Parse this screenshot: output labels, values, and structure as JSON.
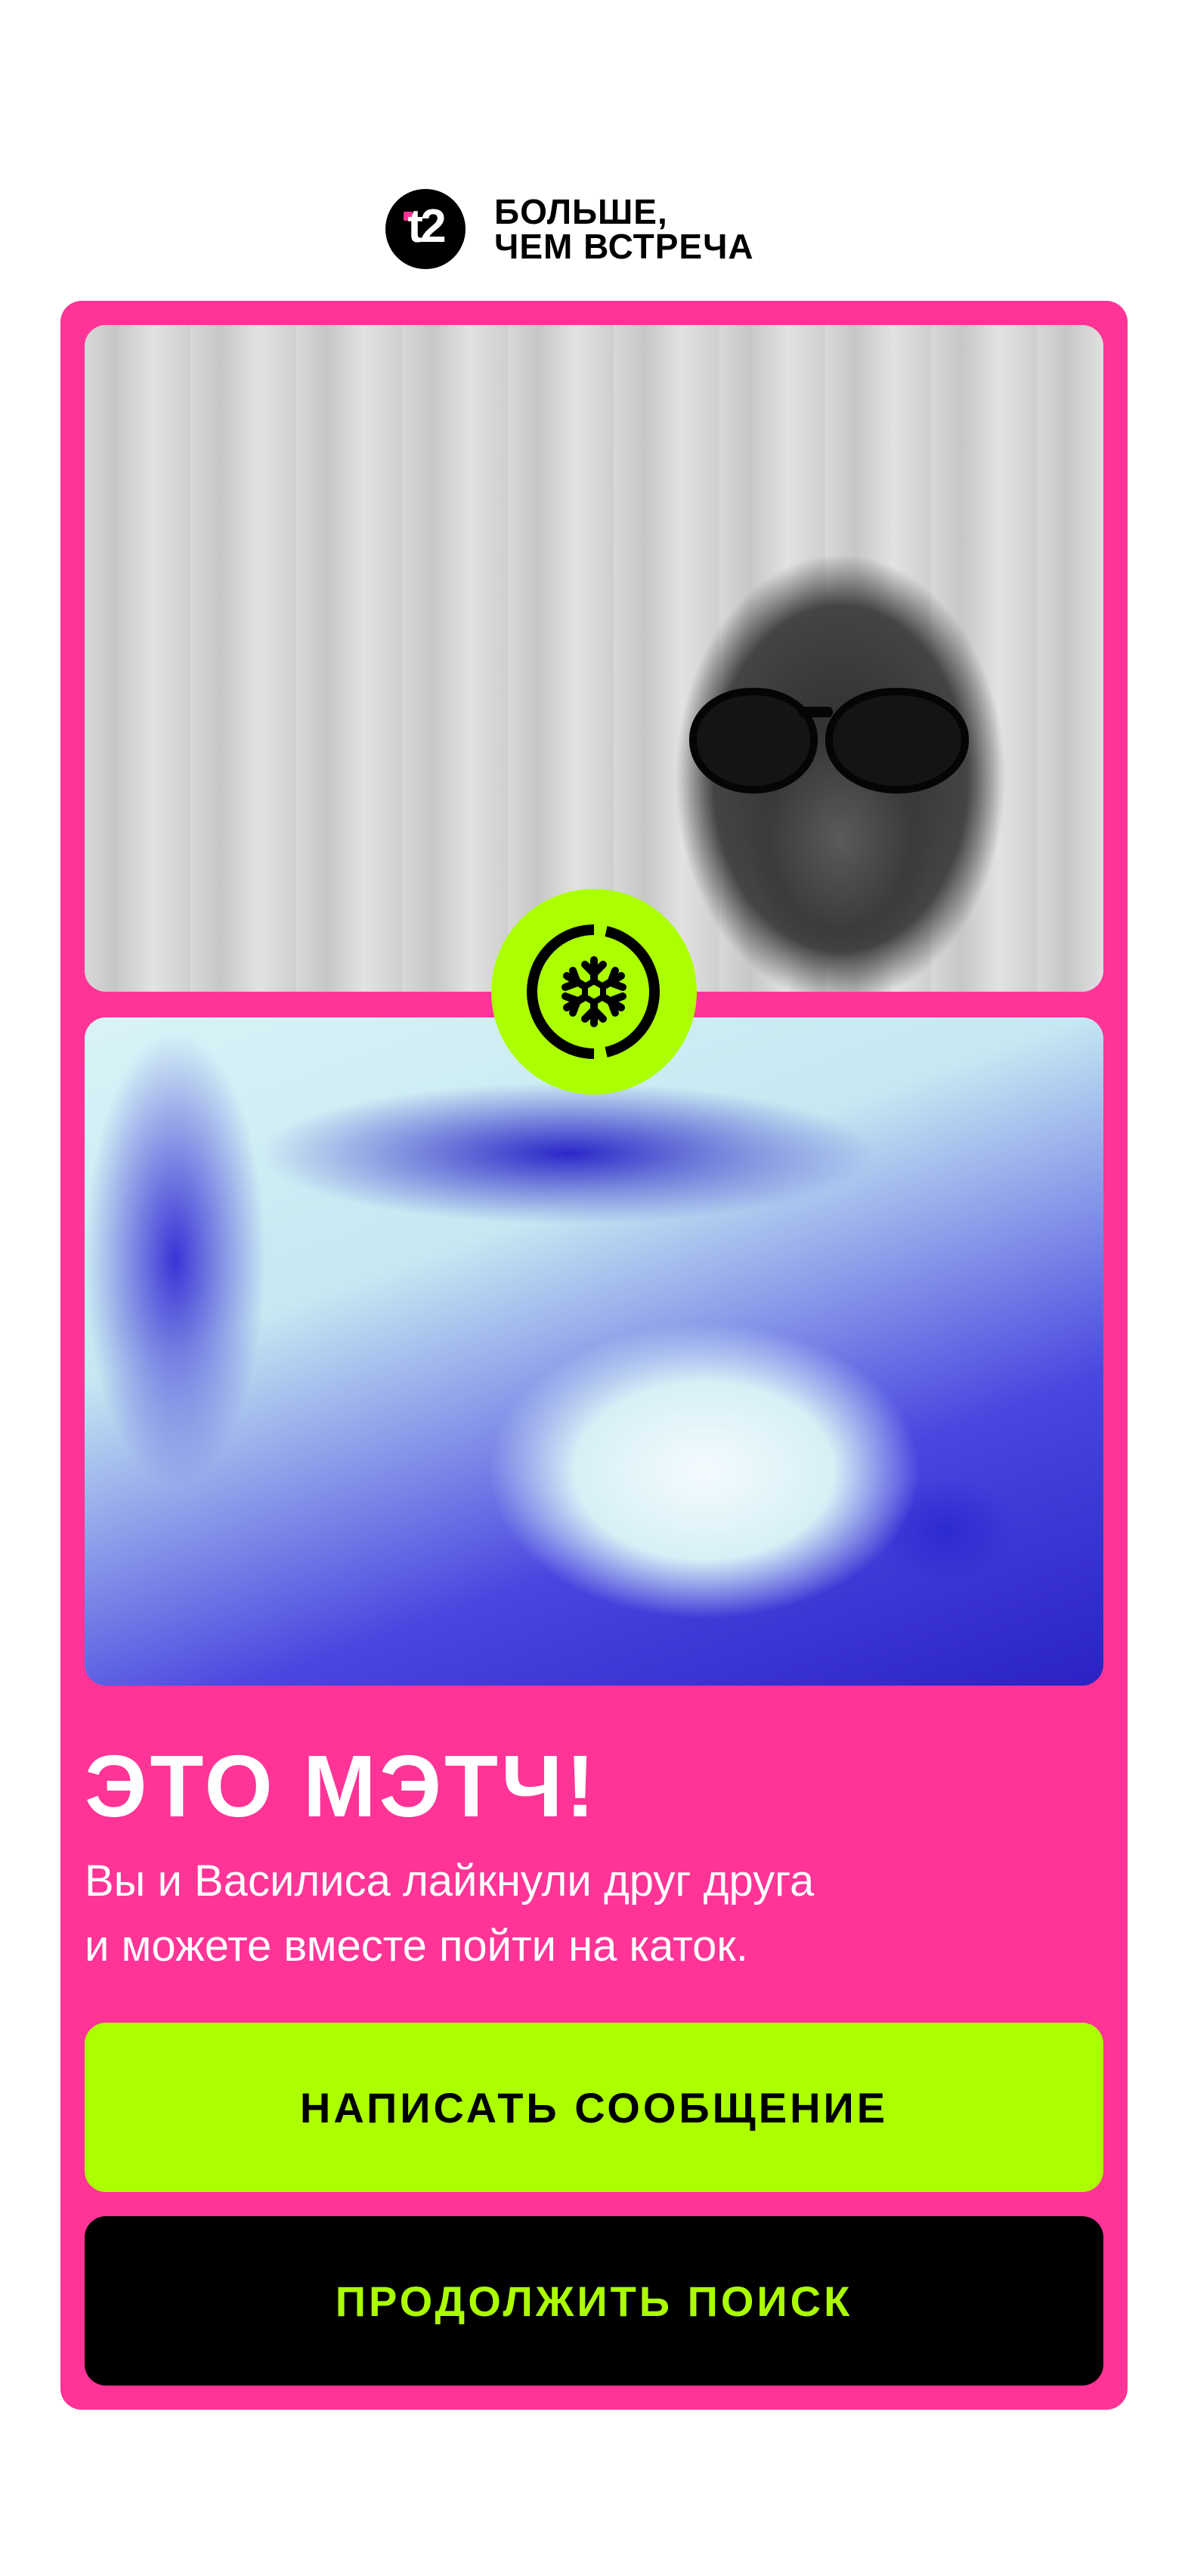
{
  "header": {
    "logo_text": "t2",
    "slogan_line1": "БОЛЬШЕ,",
    "slogan_line2": "ЧЕМ ВСТРЕЧА"
  },
  "match": {
    "title": "ЭТО МЭТЧ!",
    "description_line1": "Вы и Василиса лайкнули друг друга",
    "description_line2": "и можете вместе пойти на каток."
  },
  "buttons": {
    "primary_label": "НАПИСАТЬ СООБЩЕНИЕ",
    "secondary_label": "ПРОДОЛЖИТЬ ПОИСК"
  },
  "icons": {
    "logo": "t2-logo-icon",
    "badge": "snowflake-icon"
  },
  "colors": {
    "card_bg": "#ff3496",
    "accent_lime": "#abff00",
    "black": "#000000",
    "white": "#ffffff"
  }
}
